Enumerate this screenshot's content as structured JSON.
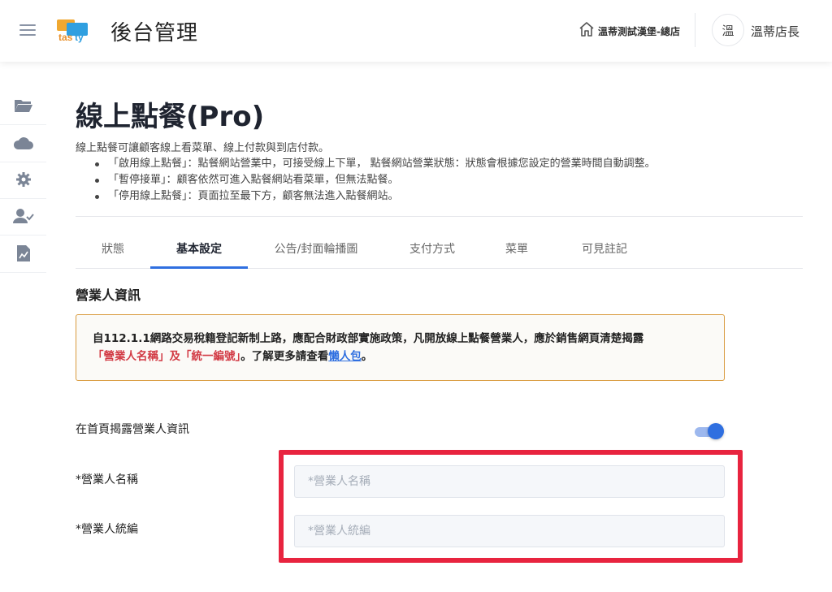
{
  "header": {
    "app_title": "後台管理",
    "logo_text": "tasty",
    "store_name": "溫蒂測試漢堡-總店",
    "avatar_text": "溫",
    "user_name": "溫蒂店長"
  },
  "sidebar": {
    "items": [
      {
        "icon": "folder-icon"
      },
      {
        "icon": "cloud-icon"
      },
      {
        "icon": "gear-icon"
      },
      {
        "icon": "user-check-icon"
      },
      {
        "icon": "report-icon"
      }
    ]
  },
  "page": {
    "title": "線上點餐(Pro)",
    "description": "線上點餐可讓顧客線上看菜單、線上付款與到店付款。",
    "bullets": [
      "「啟用線上點餐」：點餐網站營業中，可接受線上下單， 點餐網站營業狀態：狀態會根據您設定的營業時間自動調整。",
      "「暫停接單」：顧客依然可進入點餐網站看菜單，但無法點餐。",
      "「停用線上點餐」：頁面拉至最下方，顧客無法進入點餐網站。"
    ]
  },
  "tabs": [
    {
      "label": "狀態"
    },
    {
      "label": "基本設定"
    },
    {
      "label": "公告/封面輪播圖"
    },
    {
      "label": "支付方式"
    },
    {
      "label": "菜單"
    },
    {
      "label": "可見註記"
    }
  ],
  "section": {
    "title": "營業人資訊",
    "notice_line1": "自112.1.1網路交易稅籍登記新制上路，應配合財政部實施政策，凡開放線上點餐營業人，應於銷售網頁清楚揭露",
    "notice_red": "「營業人名稱」及「統一編號」",
    "notice_tail": "。了解更多請查看",
    "notice_link": "懶人包",
    "notice_end": "。",
    "toggle_label": "在首頁揭露營業人資訊",
    "toggle_on": true,
    "name_label": "*營業人名稱",
    "name_placeholder": "*營業人名稱",
    "name_value": "",
    "taxid_label": "*營業人統編",
    "taxid_placeholder": "*營業人統編",
    "taxid_value": ""
  },
  "colors": {
    "accent": "#2f6fe0",
    "notice_border": "#d99a3c",
    "highlight": "#e8243f",
    "red_text": "#d23a44"
  }
}
